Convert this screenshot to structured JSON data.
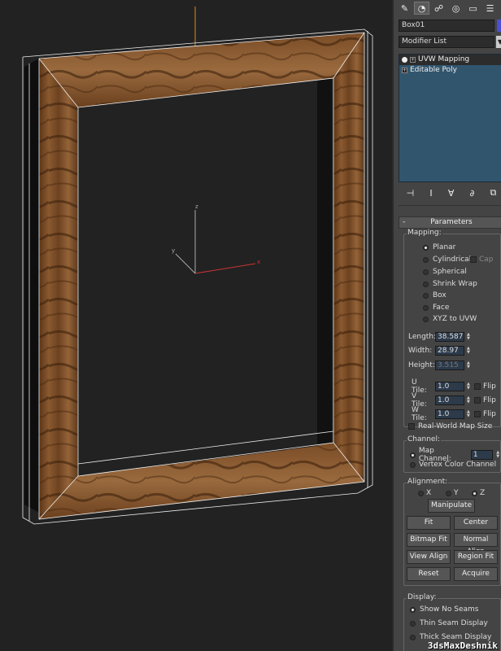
{
  "viewport": {
    "axes": {
      "x": "x",
      "y": "y",
      "z": "z"
    }
  },
  "toolbar": {
    "tabs": [
      {
        "icon": "create-icon",
        "glyph": "✎"
      },
      {
        "icon": "modify-icon",
        "glyph": "◔"
      },
      {
        "icon": "hierarchy-icon",
        "glyph": "☍"
      },
      {
        "icon": "motion-icon",
        "glyph": "◎"
      },
      {
        "icon": "display-icon",
        "glyph": "▭"
      },
      {
        "icon": "utilities-icon",
        "glyph": "☰"
      }
    ]
  },
  "object_name": "Box01",
  "modifier_list": "Modifier List",
  "stack": {
    "items": [
      "UVW Mapping",
      "Editable Poly"
    ]
  },
  "stack_bar": [
    "⊣",
    "I",
    "∀",
    "∂",
    "⧉"
  ],
  "parameters": {
    "title": "Parameters",
    "mapping": {
      "label": "Mapping:",
      "options": [
        "Planar",
        "Cylindrical",
        "Spherical",
        "Shrink Wrap",
        "Box",
        "Face",
        "XYZ to UVW"
      ],
      "selected": "Planar",
      "cap_label": "Cap"
    },
    "length": {
      "label": "Length:",
      "value": "38.587"
    },
    "width": {
      "label": "Width:",
      "value": "28.97"
    },
    "height": {
      "label": "Height:",
      "value": "3.515"
    },
    "u_tile": {
      "label": "U Tile:",
      "value": "1.0"
    },
    "v_tile": {
      "label": "V Tile:",
      "value": "1.0"
    },
    "w_tile": {
      "label": "W Tile:",
      "value": "1.0"
    },
    "flip": "Flip",
    "real_world": "Real-World Map Size",
    "channel": {
      "label": "Channel:",
      "map_channel": "Map Channel:",
      "map_channel_value": "1",
      "vertex_color": "Vertex Color Channel"
    },
    "alignment": {
      "label": "Alignment:",
      "x": "X",
      "y": "Y",
      "z": "Z",
      "selected": "Z",
      "manipulate": "Manipulate",
      "buttons": [
        "Fit",
        "Center",
        "Bitmap Fit",
        "Normal Align",
        "View Align",
        "Region Fit",
        "Reset",
        "Acquire"
      ]
    },
    "display": {
      "label": "Display:",
      "options": [
        "Show No Seams",
        "Thin Seam Display",
        "Thick Seam Display"
      ],
      "selected": "Show No Seams"
    }
  },
  "watermark": "3dsMaxDeshnik"
}
